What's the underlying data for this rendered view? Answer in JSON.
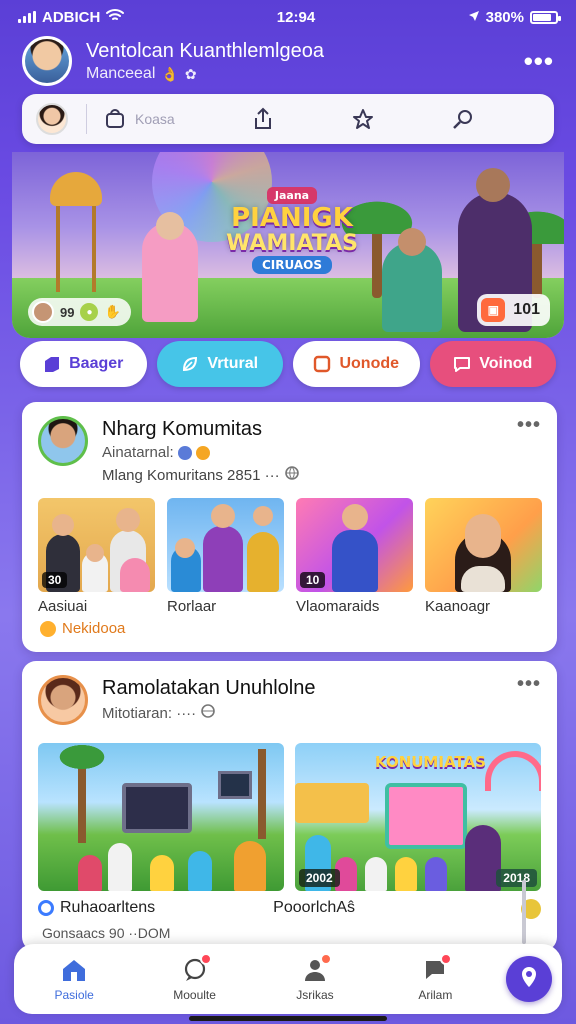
{
  "status_bar": {
    "carrier": "ADBICH",
    "time": "12:94",
    "battery": "380%"
  },
  "header": {
    "title": "Ventolcan Kuanthlemlgeoa",
    "subtitle": "Manceeal"
  },
  "toolbar": {
    "item2_label": "Koasa"
  },
  "banner": {
    "art_top": "Jaana",
    "art_line1": "PIANIGK",
    "art_line2": "WAMIATAS",
    "art_bottom": "CIRUAOS",
    "left_stat": "99",
    "right_count": "101"
  },
  "chips": [
    {
      "label": "Baager",
      "bg": "#ffffff",
      "fg": "#5a3fd6",
      "icon": "tag-icon"
    },
    {
      "label": "Vrtural",
      "bg": "#46c5e8",
      "fg": "#ffffff",
      "icon": "leaf-icon"
    },
    {
      "label": "Uonode",
      "bg": "#ffffff",
      "fg": "#e0582a",
      "icon": "square-icon"
    },
    {
      "label": "Voinod",
      "bg": "#e74f7d",
      "fg": "#ffffff",
      "icon": "message-icon"
    }
  ],
  "card1": {
    "title": "Nharg Komumitas",
    "subtitle": "Ainatarnal:",
    "detail": "Mlang Komuritans 2851 ···",
    "thumbs": [
      {
        "label": "Aasiuai",
        "badge": "30"
      },
      {
        "label": "Rorlaar",
        "badge": ""
      },
      {
        "label": "Vlaomaraids",
        "badge": "10"
      },
      {
        "label": "Kaanoagr",
        "badge": ""
      }
    ],
    "footer": "Nekidooa"
  },
  "card2": {
    "title": "Ramolatakan Unuhlolne",
    "subtitle": "Mitotiaran: ····",
    "thumb_left_badge": "",
    "thumb_right_title": "KONUMIATAS",
    "badge_left": "2002",
    "badge_right": "2018",
    "label_left": "Ruhaoarltens",
    "label_right": "PooorlchAŝ",
    "sub_left": "Gonsaacs 90 ··DOM"
  },
  "bottom_nav": [
    {
      "label": "Pasiole",
      "icon": "home-icon",
      "active": true
    },
    {
      "label": "Mooulte",
      "icon": "chat-icon",
      "active": false
    },
    {
      "label": "Jsrikas",
      "icon": "people-icon",
      "active": false
    },
    {
      "label": "Arilam",
      "icon": "notification-icon",
      "active": false
    }
  ],
  "colors": {
    "accent": "#5a3fd6",
    "background_top": "#5b3fd6",
    "active_nav": "#3f6ddc"
  }
}
